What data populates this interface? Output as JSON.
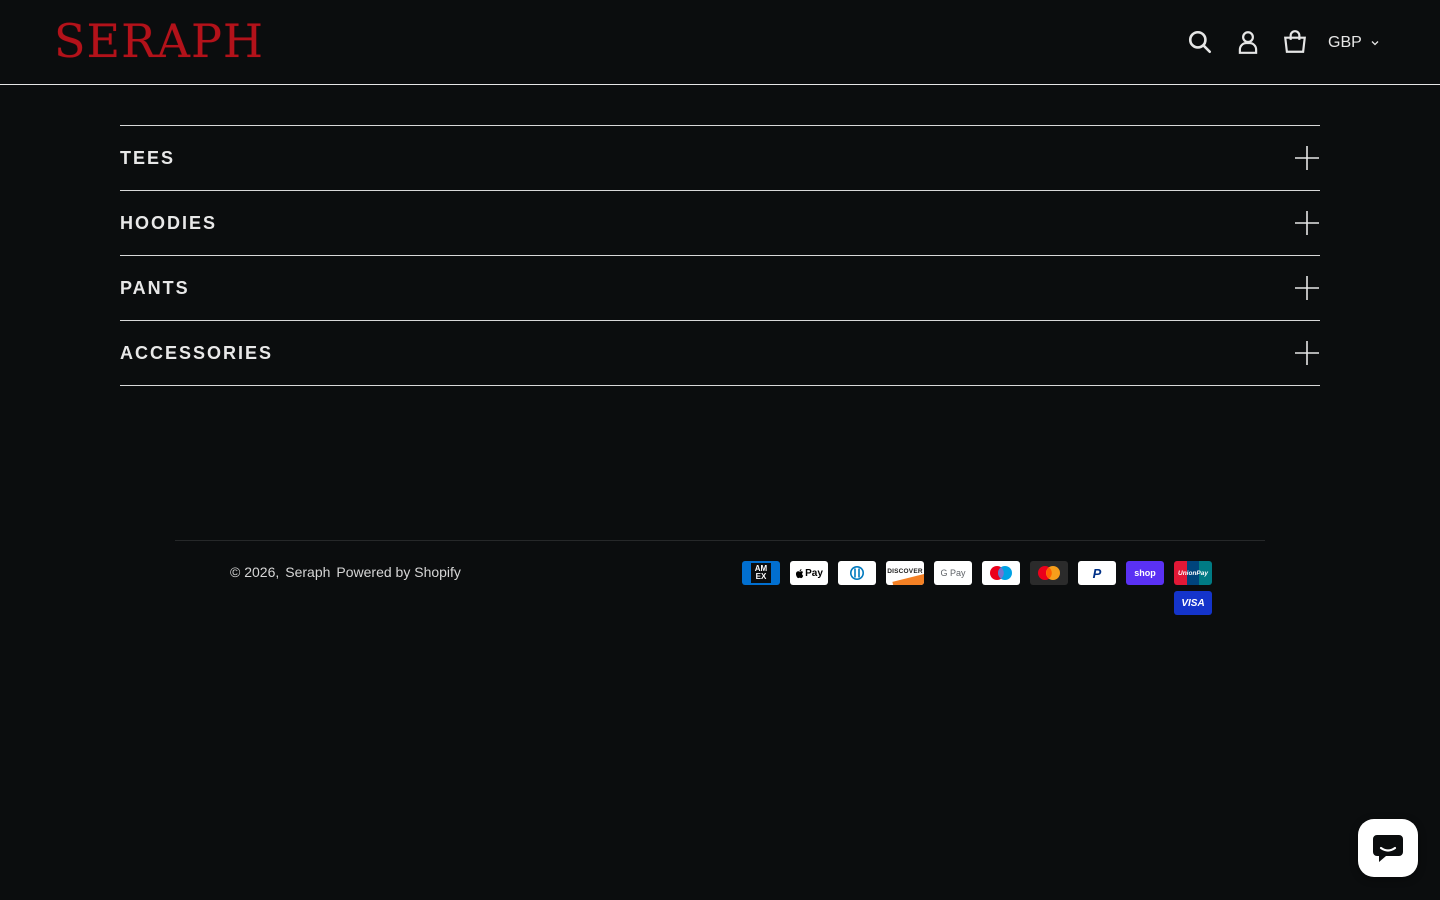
{
  "brand": {
    "name": "SERAPH",
    "color": "#b3121a"
  },
  "header": {
    "icons": [
      "search-icon",
      "account-icon",
      "cart-icon"
    ],
    "currency": "GBP"
  },
  "accordion": {
    "items": [
      {
        "label": "TEES"
      },
      {
        "label": "HOODIES"
      },
      {
        "label": "PANTS"
      },
      {
        "label": "ACCESSORIES"
      }
    ]
  },
  "footer": {
    "copyright_prefix": "© 2026,",
    "store_name": "Seraph",
    "powered_by": "Powered by Shopify"
  },
  "payments": {
    "row1": [
      "American Express",
      "Apple Pay",
      "Diners Club",
      "Discover",
      "Google Pay",
      "Maestro",
      "Mastercard",
      "PayPal",
      "Shop Pay",
      "Union Pay"
    ],
    "row2": [
      "Visa"
    ],
    "labels": {
      "amex": "AM EX",
      "applepay": "Pay",
      "discover": "DISCOVER",
      "gpay": "G Pay",
      "shop": "shop",
      "unionpay": "UnionPay",
      "visa": "VISA",
      "paypal": "P"
    }
  },
  "colors": {
    "background": "#0b0d0e",
    "divider": "#d8d8d8",
    "text": "#e8e8e8"
  }
}
